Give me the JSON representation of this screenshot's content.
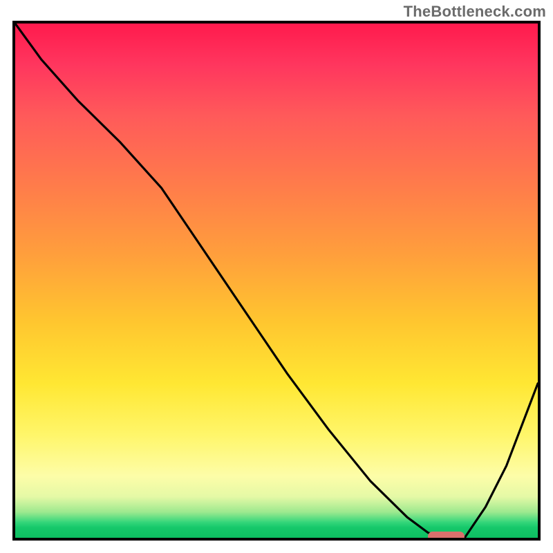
{
  "watermark": "TheBottleneck.com",
  "chart_data": {
    "type": "line",
    "title": "",
    "xlabel": "",
    "ylabel": "",
    "xlim": [
      0,
      100
    ],
    "ylim": [
      0,
      100
    ],
    "grid": false,
    "legend": false,
    "series": [
      {
        "name": "bottleneck-curve",
        "x": [
          0,
          5,
          12,
          20,
          28,
          36,
          44,
          52,
          60,
          68,
          75,
          79,
          82,
          86,
          90,
          94,
          100
        ],
        "y": [
          100,
          93,
          85,
          77,
          68,
          56,
          44,
          32,
          21,
          11,
          4,
          1,
          0,
          0,
          6,
          14,
          30
        ]
      }
    ],
    "optimal_range": {
      "start": 79,
      "end": 86,
      "value": 0
    },
    "gradient_stops": [
      {
        "pct": 0,
        "color": "#ff1a4d"
      },
      {
        "pct": 18,
        "color": "#ff5a5a"
      },
      {
        "pct": 45,
        "color": "#ff9f3c"
      },
      {
        "pct": 70,
        "color": "#ffe733"
      },
      {
        "pct": 88,
        "color": "#fdfda8"
      },
      {
        "pct": 97,
        "color": "#33d67a"
      },
      {
        "pct": 100,
        "color": "#0dbf62"
      }
    ]
  }
}
